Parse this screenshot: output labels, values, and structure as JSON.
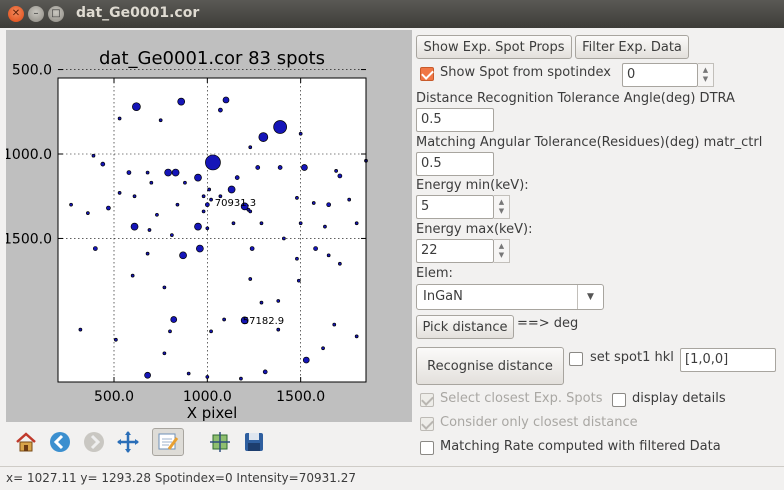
{
  "window": {
    "title": "dat_Ge0001.cor"
  },
  "controls": {
    "show_exp_spot_props": "Show Exp. Spot Props",
    "filter_exp_data": "Filter Exp. Data",
    "show_spot_label": "Show Spot from spotindex",
    "spot_index_value": "0",
    "dtra_label": "Distance Recognition Tolerance Angle(deg) DTRA",
    "dtra_value": "0.5",
    "matr_label": "Matching Angular Tolerance(Residues)(deg) matr_ctrl",
    "matr_value": "0.5",
    "emin_label": "Energy min(keV):",
    "emin_value": "5",
    "emax_label": "Energy max(keV):",
    "emax_value": "22",
    "elem_label": "Elem:",
    "elem_value": "InGaN",
    "pick_distance": "Pick distance",
    "deg_label": "==> deg",
    "recognise_distance": "Recognise distance",
    "set_spot1_label": "set spot1 hkl",
    "spot1_hkl_value": "[1,0,0]",
    "select_closest": "Select closest Exp. Spots",
    "display_details": "display details",
    "consider_closest": "Consider only closest distance",
    "matching_rate": "Matching Rate computed with filtered Data"
  },
  "status": {
    "text": "x= 1027.11  y= 1293.28   Spotindex=0   Intensity=70931.27"
  },
  "chart_data": {
    "type": "scatter",
    "title": "dat_Ge0001.cor 83 spots",
    "xlabel": "X pixel",
    "ylabel": "",
    "xlim": [
      200,
      1850
    ],
    "ylim": [
      2350,
      550
    ],
    "xticks": [
      "500.0",
      "1000.0",
      "1500.0"
    ],
    "yticks": [
      "500.0",
      "1000.0",
      "1500.0"
    ],
    "grid": true,
    "annotations": [
      {
        "text": "70931.3",
        "x": 1040,
        "y": 1290
      },
      {
        "text": "57182.9",
        "x": 1190,
        "y": 1990
      }
    ],
    "points": [
      [
        620,
        720,
        4
      ],
      [
        860,
        690,
        3.5
      ],
      [
        1100,
        680,
        3
      ],
      [
        1070,
        740,
        2
      ],
      [
        530,
        790,
        1.5
      ],
      [
        750,
        800,
        1.5
      ],
      [
        1390,
        840,
        6.5
      ],
      [
        1300,
        900,
        4.5
      ],
      [
        1500,
        880,
        1.5
      ],
      [
        1230,
        960,
        1.5
      ],
      [
        390,
        1010,
        1.5
      ],
      [
        440,
        1060,
        2
      ],
      [
        580,
        1110,
        2
      ],
      [
        680,
        1110,
        1.5
      ],
      [
        790,
        1110,
        3.5
      ],
      [
        830,
        1110,
        3.5
      ],
      [
        1030,
        1050,
        7.5
      ],
      [
        1270,
        1080,
        2
      ],
      [
        1390,
        1080,
        2
      ],
      [
        1520,
        1080,
        3
      ],
      [
        1850,
        1040,
        1.5
      ],
      [
        1690,
        1100,
        1.5
      ],
      [
        1710,
        1130,
        2
      ],
      [
        950,
        1140,
        3.5
      ],
      [
        700,
        1170,
        1.5
      ],
      [
        880,
        1170,
        1.5
      ],
      [
        1160,
        1140,
        2
      ],
      [
        1130,
        1210,
        3.5
      ],
      [
        1200,
        1310,
        3.5
      ],
      [
        530,
        1230,
        1.5
      ],
      [
        610,
        1250,
        1.5
      ],
      [
        980,
        1250,
        1.5
      ],
      [
        1010,
        1210,
        1.5
      ],
      [
        1020,
        1270,
        1.5
      ],
      [
        1070,
        1250,
        1.5
      ],
      [
        1000,
        1300,
        2
      ],
      [
        1220,
        1330,
        1.5
      ],
      [
        1480,
        1260,
        1.5
      ],
      [
        1570,
        1290,
        1.5
      ],
      [
        1760,
        1270,
        1.5
      ],
      [
        1650,
        1300,
        2
      ],
      [
        270,
        1300,
        1.5
      ],
      [
        360,
        1350,
        1.5
      ],
      [
        470,
        1320,
        2
      ],
      [
        730,
        1360,
        1.5
      ],
      [
        980,
        1340,
        1.5
      ],
      [
        1230,
        1340,
        1.5
      ],
      [
        840,
        1300,
        1.5
      ],
      [
        1000,
        1440,
        1.5
      ],
      [
        610,
        1430,
        3.5
      ],
      [
        950,
        1430,
        3.5
      ],
      [
        690,
        1450,
        1.5
      ],
      [
        1140,
        1410,
        1.5
      ],
      [
        1290,
        1410,
        1.5
      ],
      [
        1500,
        1410,
        1.5
      ],
      [
        1630,
        1430,
        1.5
      ],
      [
        1800,
        1410,
        1.5
      ],
      [
        810,
        1480,
        1.5
      ],
      [
        400,
        1560,
        2
      ],
      [
        680,
        1590,
        1.5
      ],
      [
        960,
        1560,
        3.5
      ],
      [
        1240,
        1560,
        2
      ],
      [
        1410,
        1500,
        1.5
      ],
      [
        1580,
        1560,
        2
      ],
      [
        1650,
        1600,
        1.5
      ],
      [
        1710,
        1650,
        1.5
      ],
      [
        870,
        1600,
        3.5
      ],
      [
        1480,
        1620,
        1.5
      ],
      [
        1490,
        1750,
        1.5
      ],
      [
        1230,
        1740,
        1.5
      ],
      [
        1380,
        1870,
        1.5
      ],
      [
        1090,
        1980,
        1.5
      ],
      [
        1200,
        1985,
        3.5
      ],
      [
        1290,
        1880,
        1.5
      ],
      [
        600,
        1720,
        1.5
      ],
      [
        770,
        1790,
        1.5
      ],
      [
        820,
        1980,
        3
      ],
      [
        800,
        2050,
        1.5
      ],
      [
        1020,
        2050,
        1.5
      ],
      [
        1380,
        2040,
        1.5
      ],
      [
        320,
        2040,
        1.5
      ],
      [
        510,
        2100,
        1.5
      ],
      [
        770,
        2180,
        1.5
      ],
      [
        1680,
        2010,
        1.5
      ],
      [
        1800,
        2080,
        1.5
      ],
      [
        1620,
        2150,
        1.5
      ],
      [
        1530,
        2220,
        3
      ],
      [
        1310,
        2290,
        2
      ],
      [
        900,
        2300,
        1.5
      ],
      [
        680,
        2310,
        3
      ],
      [
        1000,
        2320,
        1.5
      ],
      [
        1180,
        2330,
        1.5
      ]
    ]
  }
}
